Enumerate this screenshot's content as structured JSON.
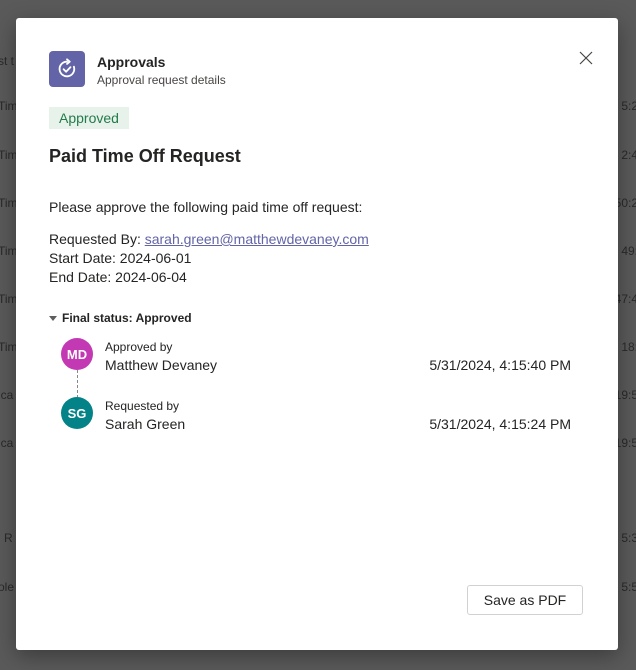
{
  "background": {
    "left_fragments": [
      "st t",
      "Tim",
      "Tim",
      "Tim",
      "Tim",
      "Tim",
      "Tim",
      "ica",
      "ica",
      "l R",
      "ole"
    ],
    "right_fragments": [
      "5:2",
      "2:4",
      "50:2",
      "49:",
      "47:4",
      "18:",
      "19:5",
      "19:5",
      "5:3",
      "5:5"
    ]
  },
  "header": {
    "app_name": "Approvals",
    "subtitle": "Approval request details",
    "icon": "approvals-icon",
    "close_icon": "close-icon"
  },
  "status_badge": "Approved",
  "request": {
    "title": "Paid Time Off Request",
    "intro": "Please approve the following paid time off request:",
    "requested_by_label": "Requested By:",
    "requested_by_email": "sarah.green@matthewdevaney.com",
    "start_date": "Start Date: 2024-06-01",
    "end_date": "End Date: 2024-06-04"
  },
  "final_status": {
    "label": "Final status: Approved",
    "entries": [
      {
        "initials": "MD",
        "role": "Approved by",
        "name": "Matthew Devaney",
        "timestamp": "5/31/2024, 4:15:40 PM",
        "color": "#c239b3"
      },
      {
        "initials": "SG",
        "role": "Requested by",
        "name": "Sarah Green",
        "timestamp": "5/31/2024, 4:15:24 PM",
        "color": "#038387"
      }
    ]
  },
  "actions": {
    "save_pdf_label": "Save as PDF"
  },
  "colors": {
    "accent": "#6264a7",
    "approved_text": "#237b4b",
    "approved_bg": "#e7f2ea"
  }
}
